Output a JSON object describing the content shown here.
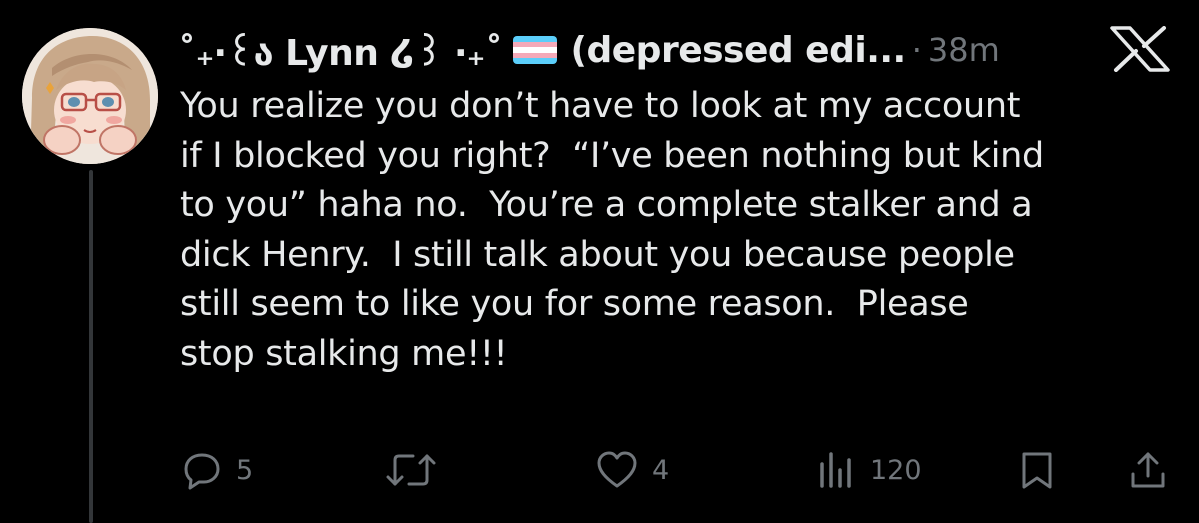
{
  "tweet": {
    "display_name": "˚₊‧꒰ა Lynn ໒꒱ ‧₊˚",
    "name_suffix": "(depressed edi...",
    "time": "38m",
    "separator": "·",
    "text": "You realize you don’t have to look at my account\nif I blocked you right?  “I’ve been nothing but kind\nto you” haha no.  You’re a complete stalker and a\ndick Henry.  I still talk about you because people\nstill seem to like you for some reason.  Please\nstop stalking me!!!",
    "flag_colors": [
      "#5BCEFA",
      "#F5A9B8",
      "#FFFFFF",
      "#F5A9B8",
      "#5BCEFA"
    ]
  },
  "actions": {
    "replies": "5",
    "retweets": "",
    "likes": "4",
    "views": "120"
  },
  "colors": {
    "background": "#000000",
    "text": "#e7e9ea",
    "muted": "#71767b",
    "thread_line": "#333639"
  },
  "icons": {
    "logo": "x-logo-icon",
    "reply": "reply-icon",
    "retweet": "retweet-icon",
    "like": "heart-icon",
    "views": "views-icon",
    "bookmark": "bookmark-icon",
    "share": "share-icon"
  }
}
